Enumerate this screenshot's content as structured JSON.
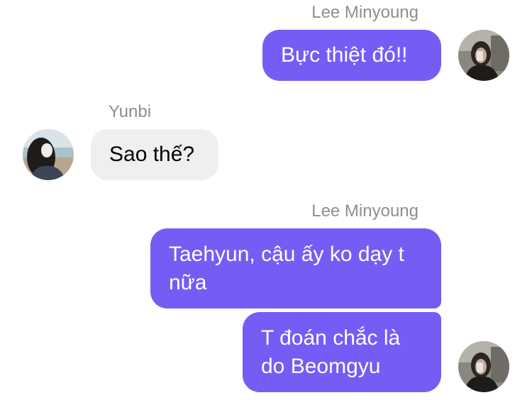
{
  "chat": {
    "groups": [
      {
        "sender": "Lee Minyoung",
        "direction": "outgoing",
        "messages": [
          "Bực thiệt đó!!"
        ],
        "avatar_icon": "profile-photo-minyoung"
      },
      {
        "sender": "Yunbi",
        "direction": "incoming",
        "messages": [
          "Sao thế?"
        ],
        "avatar_icon": "profile-photo-yunbi"
      },
      {
        "sender": "Lee Minyoung",
        "direction": "outgoing",
        "messages": [
          "Taehyun, cậu ấy ko dạy t nữa",
          "T đoán chắc là do Beomgyu"
        ],
        "avatar_icon": "profile-photo-minyoung"
      }
    ]
  },
  "colors": {
    "outgoing_bubble": "#745df5",
    "incoming_bubble": "#efeff0",
    "sender_name": "#8e8e93"
  }
}
